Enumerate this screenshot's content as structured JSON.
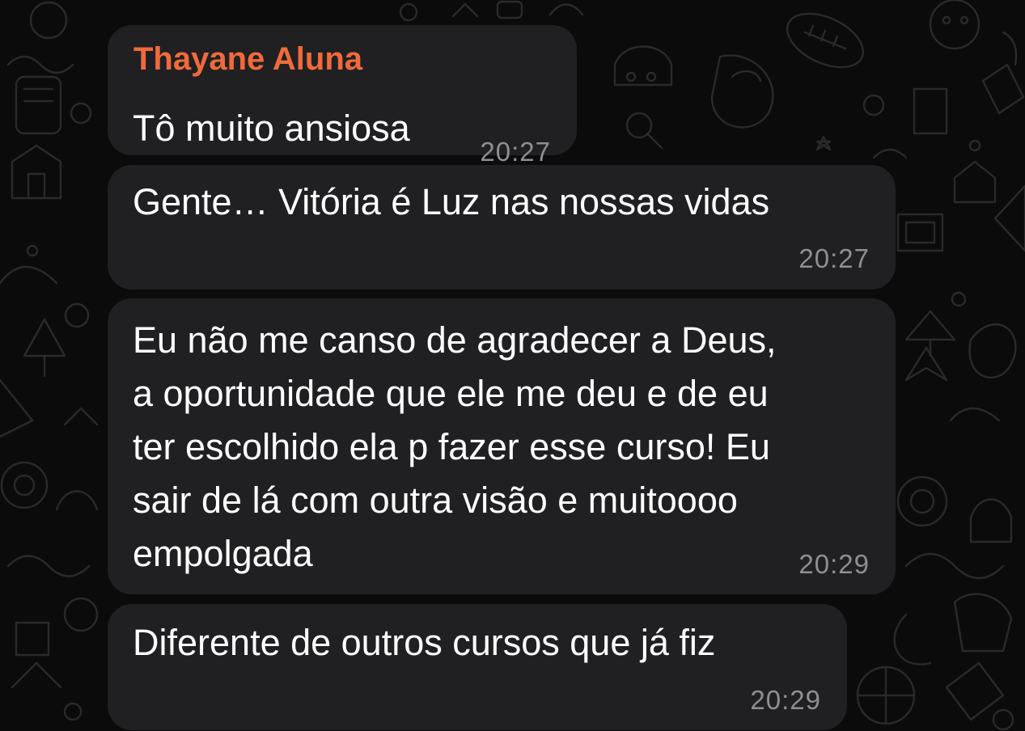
{
  "chat": {
    "background_color": "#0b0b0b",
    "bubble_color": "#202022",
    "sender_color": "#f06a3b",
    "time_color": "#8e8e93",
    "messages": [
      {
        "sender": "Thayane Aluna",
        "text": "Tô muito ansiosa",
        "time": "20:27"
      },
      {
        "text": "Gente… Vitória é Luz nas nossas vidas",
        "time": "20:27"
      },
      {
        "text": "Eu não me canso de agradecer a Deus,\na oportunidade que ele me deu e de eu\nter escolhido ela p fazer esse curso! Eu\nsair de lá com outra visão e muitoooo\nempolgada",
        "time": "20:29"
      },
      {
        "text": "Diferente de outros cursos que já fiz",
        "time": "20:29"
      }
    ]
  }
}
